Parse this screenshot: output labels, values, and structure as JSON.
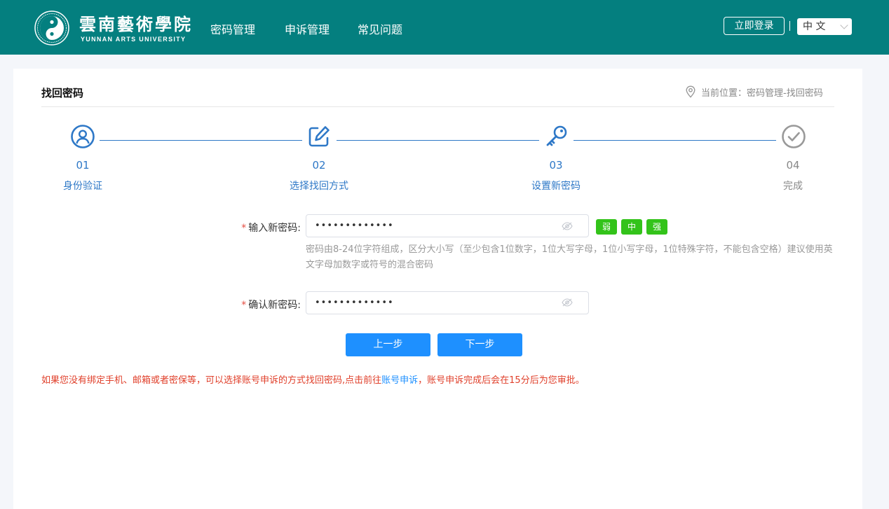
{
  "header": {
    "logo_cn": "雲南藝術學院",
    "logo_en": "YUNNAN ARTS UNIVERSITY",
    "nav": [
      "密码管理",
      "申诉管理",
      "常见问题"
    ],
    "login_label": "立即登录",
    "language": "中 文"
  },
  "page": {
    "title": "找回密码",
    "breadcrumb": "当前位置：密码管理-找回密码"
  },
  "steps": [
    {
      "num": "01",
      "label": "身份验证",
      "icon": "user-icon"
    },
    {
      "num": "02",
      "label": "选择找回方式",
      "icon": "edit-icon"
    },
    {
      "num": "03",
      "label": "设置新密码",
      "icon": "key-icon"
    },
    {
      "num": "04",
      "label": "完成",
      "icon": "check-circle-icon"
    }
  ],
  "form": {
    "new_password_label": "输入新密码:",
    "new_password_value": "•••••••••••••",
    "strength": [
      "弱",
      "中",
      "强"
    ],
    "hint": "密码由8-24位字符组成，区分大小写（至少包含1位数字，1位大写字母，1位小写字母，1位特殊字符，不能包含空格）建议使用英文字母加数字或符号的混合密码",
    "confirm_label": "确认新密码:",
    "confirm_value": "•••••••••••••",
    "required_mark": "*"
  },
  "buttons": {
    "prev": "上一步",
    "next": "下一步"
  },
  "notice": {
    "before": "如果您没有绑定手机、邮箱或者密保等，可以选择账号申诉的方式找回密码,点击前往",
    "link": "账号申诉",
    "after": "，账号申诉完成后会在15分后为您审批。"
  },
  "colors": {
    "header_bg": "#047f7f",
    "accent": "#2e78c7",
    "button": "#1e90ff",
    "strength": "#33c31a",
    "warning": "#e0402b"
  }
}
